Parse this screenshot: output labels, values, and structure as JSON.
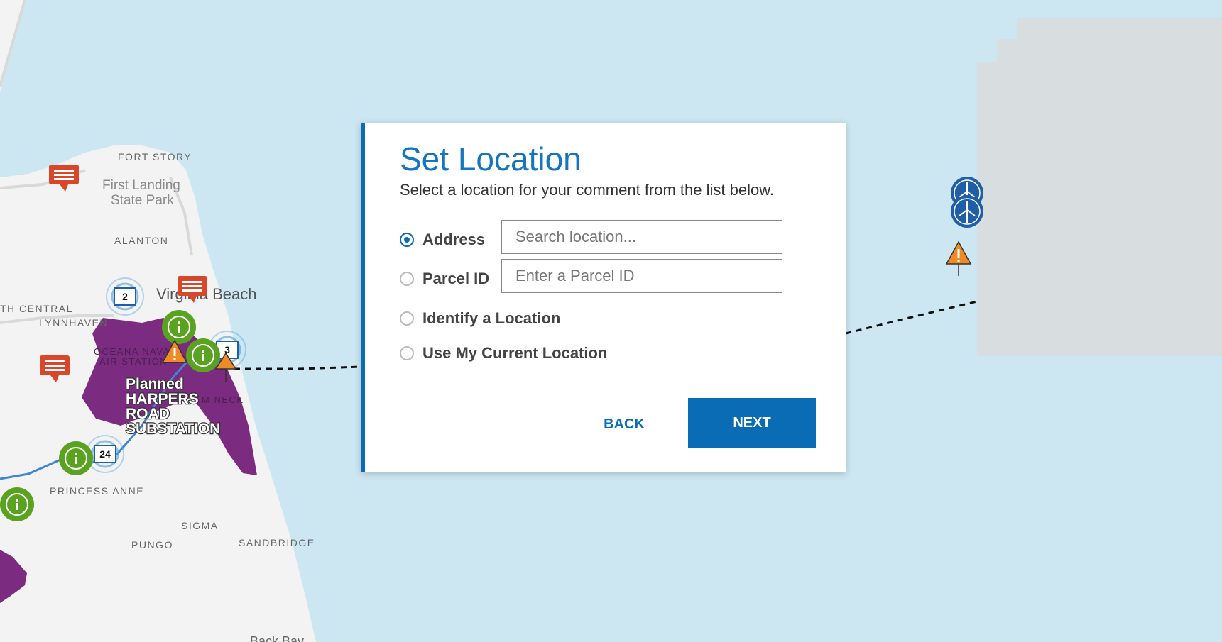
{
  "map": {
    "places": {
      "fort_story": "FORT STORY",
      "first_landing_1": "First Landing",
      "first_landing_2": "State Park",
      "alanton": "ALANTON",
      "virginia_beach": "Virginia Beach",
      "north_central": "TH CENTRAL",
      "lynnhaven": "LYNNHAVEN",
      "oceana_1": "OCEANA NAVAL",
      "oceana_2": "AIR STATION",
      "neck": "M NECK",
      "princess_anne": "PRINCESS ANNE",
      "sigma": "SIGMA",
      "pungo": "PUNGO",
      "sandbridge": "SANDBRIDGE",
      "back_bay": "Back Bay"
    },
    "substation_label": [
      "Planned",
      "HARPERS",
      "ROAD",
      "SUBSTATION"
    ],
    "cluster_counts": {
      "c2": "2",
      "c3": "3",
      "c24": "24"
    },
    "colors": {
      "water": "#cde7f2",
      "land": "#f3f3f3",
      "purple_area": "#7b2b80",
      "comment_marker": "#d9472b",
      "info_marker": "#5aa320",
      "warning_marker": "#f08a24",
      "turbine_marker": "#1f5fa8",
      "lease_area": "#d8dde0",
      "accent": "#0a6cb5"
    },
    "icons": [
      "comment-icon",
      "info-icon",
      "warning-icon",
      "wind-turbine-icon",
      "cluster-icon"
    ]
  },
  "dialog": {
    "title": "Set Location",
    "subtitle": "Select a location for your comment from the list below.",
    "options": [
      {
        "label": "Address",
        "selected": true
      },
      {
        "label": "Parcel ID",
        "selected": false
      },
      {
        "label": "Identify a Location",
        "selected": false
      },
      {
        "label": "Use My Current Location",
        "selected": false
      }
    ],
    "address_placeholder": "Search location...",
    "parcel_placeholder": "Enter a Parcel ID",
    "back_label": "BACK",
    "next_label": "NEXT"
  }
}
